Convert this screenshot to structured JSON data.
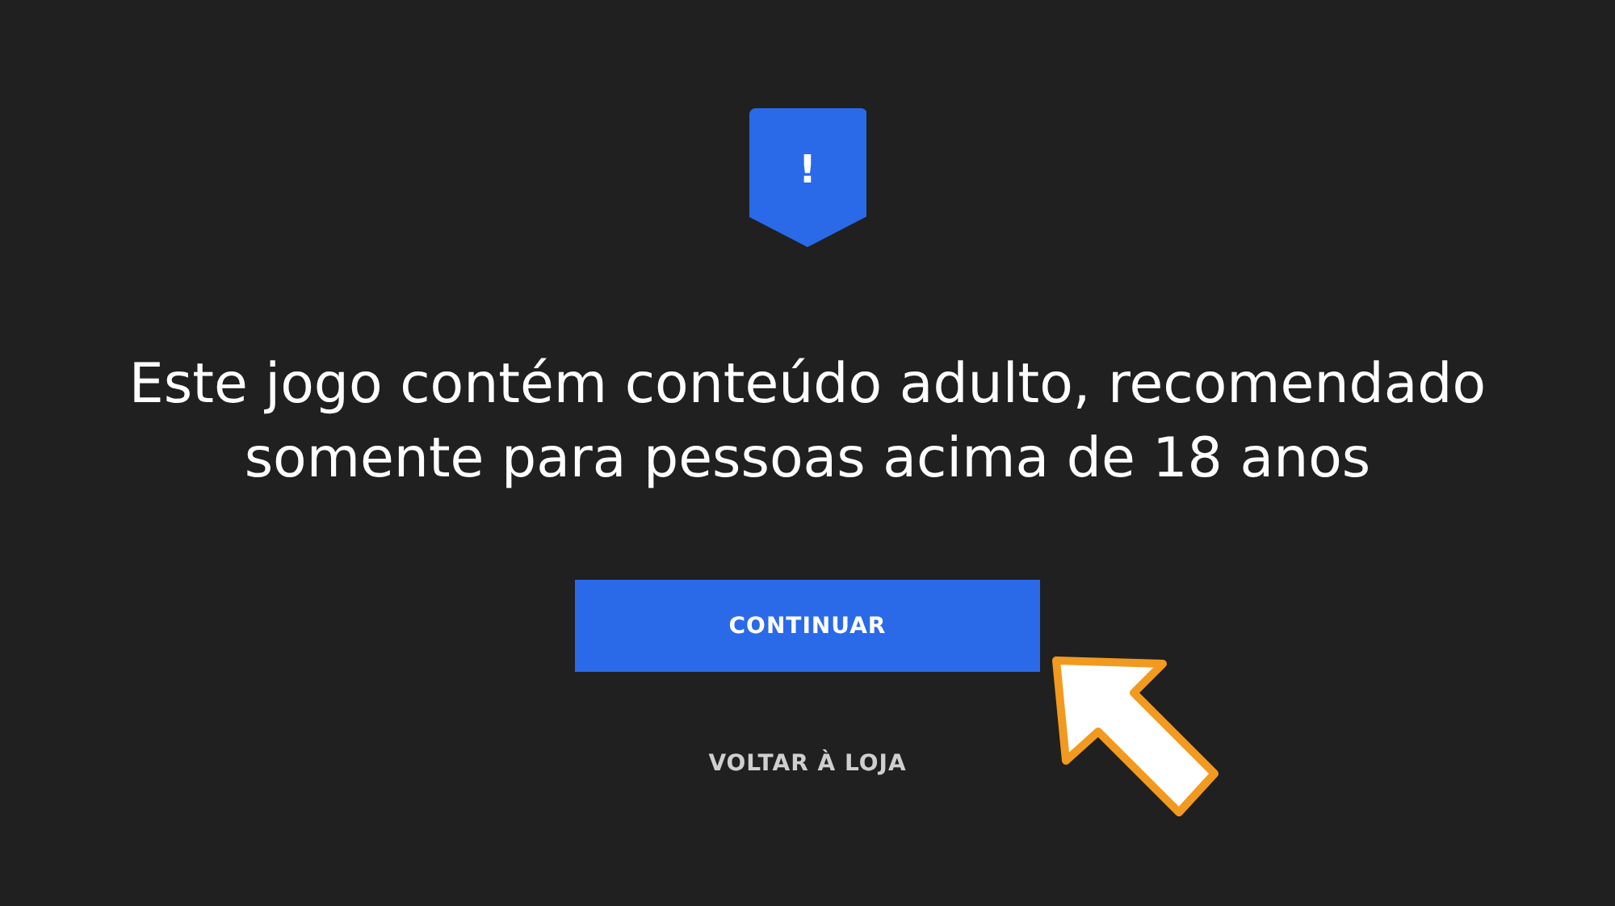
{
  "badge": {
    "symbol": "!"
  },
  "message": "Este jogo contém conteúdo adulto, recomendado somente para pessoas acima de 18 anos",
  "buttons": [
    {
      "label": "CONTINUAR",
      "kind": "primary"
    },
    {
      "label": "VOLTAR À LOJA",
      "kind": "link"
    }
  ]
}
